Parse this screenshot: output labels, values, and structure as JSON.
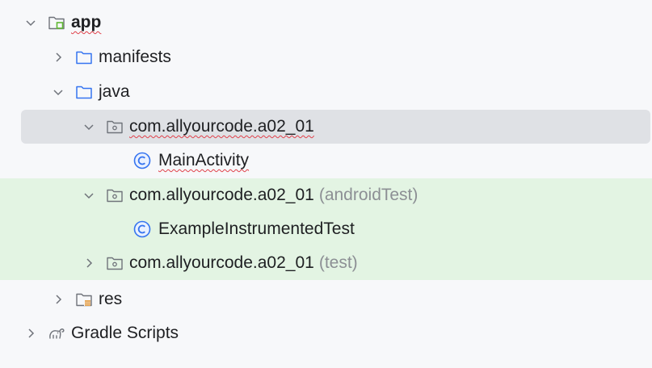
{
  "tree": {
    "app": {
      "label": "app",
      "icon": "module-folder-icon",
      "expanded": true
    },
    "manifests": {
      "label": "manifests",
      "icon": "folder-icon",
      "expanded": false
    },
    "java": {
      "label": "java",
      "icon": "folder-icon",
      "expanded": true
    },
    "pkg_main": {
      "label": "com.allyourcode.a02_01",
      "icon": "package-icon",
      "expanded": true,
      "selected": true
    },
    "main_activity": {
      "label": "MainActivity",
      "icon": "class-icon"
    },
    "pkg_android_test": {
      "label": "com.allyourcode.a02_01",
      "suffix": "(androidTest)",
      "icon": "package-icon",
      "expanded": true
    },
    "example_test": {
      "label": "ExampleInstrumentedTest",
      "icon": "class-icon"
    },
    "pkg_test": {
      "label": "com.allyourcode.a02_01",
      "suffix": "(test)",
      "icon": "package-icon",
      "expanded": false
    },
    "res": {
      "label": "res",
      "icon": "resources-folder-icon",
      "expanded": false
    },
    "gradle": {
      "label": "Gradle Scripts",
      "icon": "gradle-elephant-icon",
      "expanded": false
    }
  },
  "colors": {
    "background": "#f7f8fa",
    "selected_row": "#dfe1e5",
    "test_rows": "#e3f4e3",
    "folder_outline": "#3574f0",
    "module_badge": "#5fb832",
    "res_bars": "#e08a1e",
    "error_squiggle": "#e0404a"
  }
}
